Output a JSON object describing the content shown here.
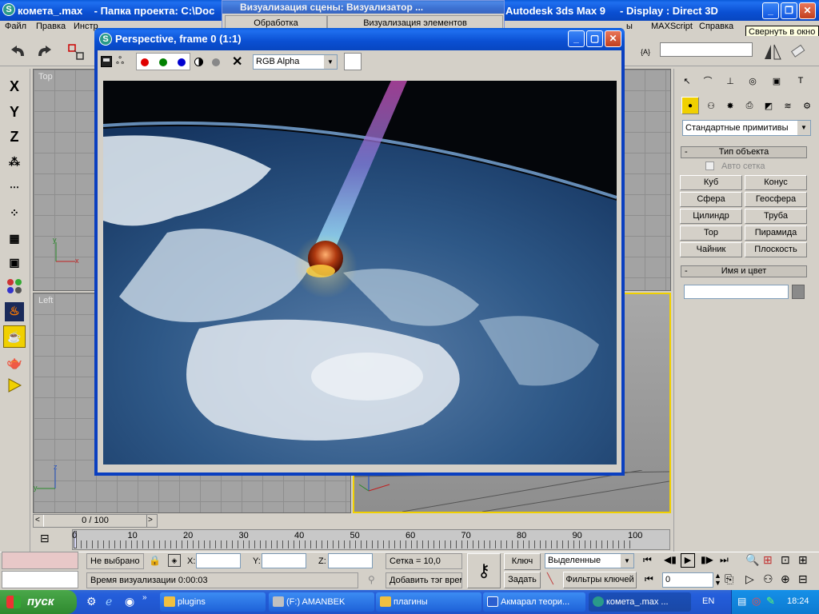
{
  "titlebar": {
    "title": "комета_.max    - Папка проекта: C:\\Doc",
    "title_right": "Autodesk 3ds Max 9     - Display : Direct 3D",
    "tooltip": "Свернуть в окно"
  },
  "menu": {
    "file": "Файл",
    "edit": "Правка",
    "tools": "Инстр",
    "maxscript": "MAXScript",
    "help": "Справка",
    "partial": "ы"
  },
  "render_scene": {
    "title": "Визуализация сцены: Визуализатор ...",
    "tab_processing": "Обработка",
    "tab_elements": "Визуализация элементов"
  },
  "frame_window": {
    "title": "Perspective, frame 0 (1:1)",
    "channel": "RGB Alpha"
  },
  "viewports": {
    "top": "Top",
    "left": "Left"
  },
  "command_panel": {
    "dropdown": "Стандартные примитивы",
    "object_type_title": "Тип объекта",
    "autogrid": "Авто сетка",
    "buttons": [
      "Куб",
      "Конус",
      "Сфера",
      "Геосфера",
      "Цилиндр",
      "Труба",
      "Тор",
      "Пирамида",
      "Чайник",
      "Плоскость"
    ],
    "name_color_title": "Имя и цвет",
    "collapse": "-"
  },
  "timeline": {
    "position": "0 / 100",
    "ticks": [
      "0",
      "10",
      "20",
      "30",
      "40",
      "50",
      "60",
      "70",
      "80",
      "90",
      "100"
    ]
  },
  "status": {
    "selection": "Не выбрано",
    "x_label": "X:",
    "y_label": "Y:",
    "z_label": "Z:",
    "grid": "Сетка = 10,0",
    "render_time": "Время визуализации  0:00:03",
    "add_tag": "Добавить тэг врем",
    "key_label": "Ключ",
    "set_label": "Задать",
    "selected_dropdown": "Выделенные",
    "key_filters": "Фильтры ключей",
    "frame": "0"
  },
  "taskbar": {
    "start": "пуск",
    "items": [
      "plugins",
      "(F:) AMANBEK",
      "плагины",
      "Акмарал теори...",
      "комета_.max ..."
    ],
    "lang": "EN",
    "clock": "18:24"
  },
  "colors": {
    "xp_blue": "#0a4fd2",
    "accent_yellow": "#f0d000",
    "taskbar": "#245edb",
    "start_green": "#3c9a3c"
  }
}
